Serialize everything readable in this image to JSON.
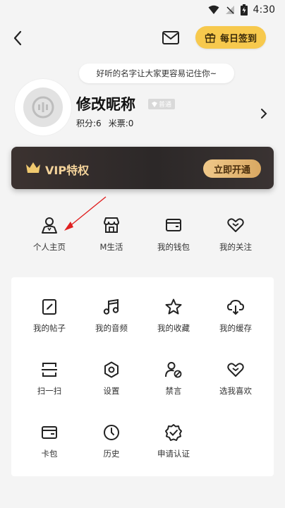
{
  "status": {
    "time": "4:30"
  },
  "header": {
    "checkin_label": "每日签到"
  },
  "profile": {
    "bubble_text": "好听的名字让大家更容易记住你~",
    "nickname": "修改昵称",
    "badge": "普通",
    "points": "积分:6",
    "tickets": "米票:0"
  },
  "vip": {
    "title": "VIP特权",
    "button": "立即开通",
    "accent": "#f3d29a"
  },
  "quick": [
    {
      "label": "个人主页",
      "icon": "person-icon"
    },
    {
      "label": "M生活",
      "icon": "shop-icon"
    },
    {
      "label": "我的钱包",
      "icon": "wallet-icon"
    },
    {
      "label": "我的关注",
      "icon": "heart-icon"
    }
  ],
  "grid": [
    {
      "label": "我的帖子",
      "icon": "edit-icon"
    },
    {
      "label": "我的音频",
      "icon": "music-icon"
    },
    {
      "label": "我的收藏",
      "icon": "star-icon"
    },
    {
      "label": "我的缓存",
      "icon": "cloud-download-icon"
    },
    {
      "label": "扫一扫",
      "icon": "scan-icon"
    },
    {
      "label": "设置",
      "icon": "settings-icon"
    },
    {
      "label": "禁言",
      "icon": "user-block-icon"
    },
    {
      "label": "选我喜欢",
      "icon": "heart-icon"
    },
    {
      "label": "卡包",
      "icon": "card-icon"
    },
    {
      "label": "历史",
      "icon": "clock-icon"
    },
    {
      "label": "申请认证",
      "icon": "verified-icon"
    }
  ],
  "colors": {
    "accent": "#f7c94d",
    "annotation": "#e02020"
  }
}
